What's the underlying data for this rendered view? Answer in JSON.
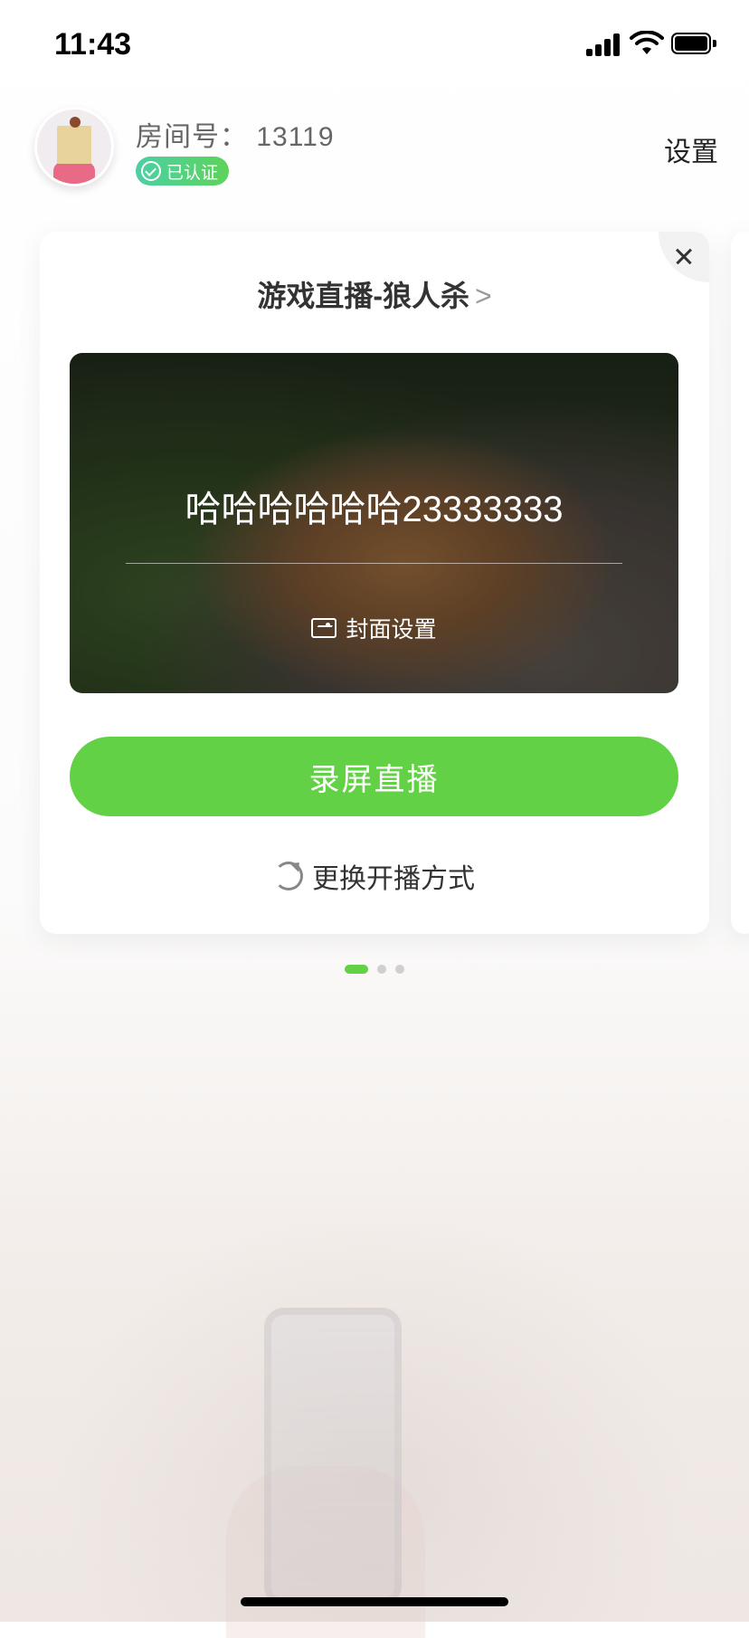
{
  "status_bar": {
    "time": "11:43"
  },
  "header": {
    "room_label": "房间号：  13119",
    "verified_badge": "已认证",
    "settings": "设置"
  },
  "card": {
    "category_title": "游戏直播-狼人杀",
    "category_chevron": ">",
    "cover": {
      "title": "哈哈哈哈哈哈23333333",
      "cover_settings_label": "封面设置"
    },
    "primary_button": "录屏直播",
    "switch_mode_label": "更换开播方式"
  },
  "pagination": {
    "current": 1,
    "total": 3
  },
  "colors": {
    "accent": "#63d145",
    "badge_start": "#4cd0a5",
    "badge_end": "#5ed35a"
  },
  "icons": [
    "signal-icon",
    "wifi-icon",
    "battery-icon",
    "check-circle-icon",
    "close-icon",
    "image-icon",
    "refresh-icon"
  ]
}
